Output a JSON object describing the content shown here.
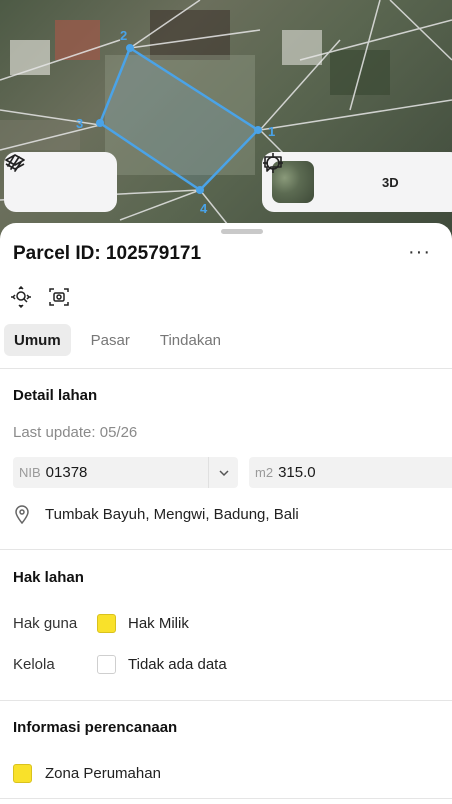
{
  "map": {
    "vertex_labels": [
      "1",
      "2",
      "3",
      "4"
    ],
    "controls_left": [
      {
        "icon": "layers-icon"
      },
      {
        "icon": "draw-icon"
      }
    ],
    "controls_right": {
      "thumbnail": "satellite-thumbnail",
      "locate_icon": "crosshair-icon",
      "mode_3d": "3D",
      "message_icon": "message-icon"
    }
  },
  "sheet": {
    "title": "Parcel ID: 102579171",
    "more": "···",
    "tools": [
      {
        "icon": "zoom-to-parcel-icon"
      },
      {
        "icon": "screenshot-icon"
      }
    ],
    "tabs": [
      {
        "label": "Umum",
        "active": true
      },
      {
        "label": "Pasar",
        "active": false
      },
      {
        "label": "Tindakan",
        "active": false
      }
    ]
  },
  "detail": {
    "title": "Detail lahan",
    "last_update": "Last update: 05/26",
    "nib_prefix": "NIB",
    "nib_value": "01378",
    "area_prefix": "m2",
    "area_value": "315.0",
    "location": "Tumbak Bayuh, Mengwi, Badung, Bali"
  },
  "hak": {
    "title": "Hak lahan",
    "rows": [
      {
        "label": "Hak guna",
        "value": "Hak Milik",
        "color": "#f9e12a"
      },
      {
        "label": "Kelola",
        "value": "Tidak ada data",
        "color": "#ffffff"
      }
    ]
  },
  "planning": {
    "title": "Informasi perencanaan",
    "zone": "Zona Perumahan",
    "zone_color": "#f9e12a"
  }
}
